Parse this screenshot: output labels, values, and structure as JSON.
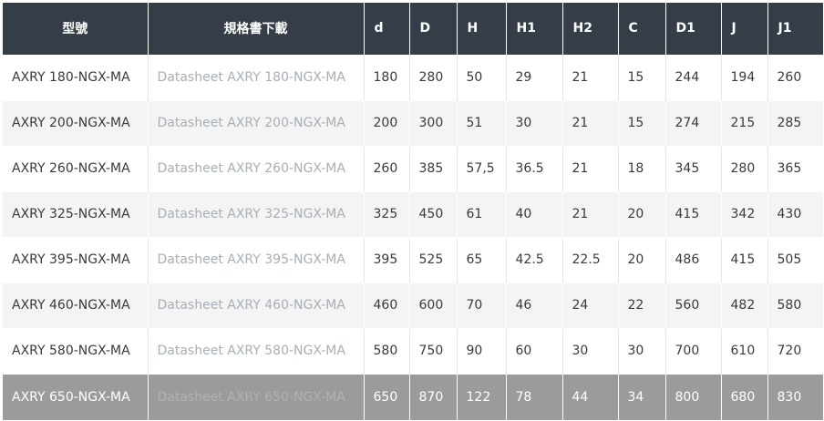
{
  "table": {
    "headers": [
      "型號",
      "規格書下載",
      "d",
      "D",
      "H",
      "H1",
      "H2",
      "C",
      "D1",
      "J",
      "J1"
    ],
    "rows": [
      [
        "AXRY 180-NGX-MA",
        "Datasheet AXRY 180-NGX-MA",
        "180",
        "280",
        "50",
        "29",
        "21",
        "15",
        "244",
        "194",
        "260"
      ],
      [
        "AXRY 200-NGX-MA",
        "Datasheet AXRY 200-NGX-MA",
        "200",
        "300",
        "51",
        "30",
        "21",
        "15",
        "274",
        "215",
        "285"
      ],
      [
        "AXRY 260-NGX-MA",
        "Datasheet AXRY 260-NGX-MA",
        "260",
        "385",
        "57,5",
        "36.5",
        "21",
        "18",
        "345",
        "280",
        "365"
      ],
      [
        "AXRY 325-NGX-MA",
        "Datasheet AXRY 325-NGX-MA",
        "325",
        "450",
        "61",
        "40",
        "21",
        "20",
        "415",
        "342",
        "430"
      ],
      [
        "AXRY 395-NGX-MA",
        "Datasheet AXRY 395-NGX-MA",
        "395",
        "525",
        "65",
        "42.5",
        "22.5",
        "20",
        "486",
        "415",
        "505"
      ],
      [
        "AXRY 460-NGX-MA",
        "Datasheet AXRY 460-NGX-MA",
        "460",
        "600",
        "70",
        "46",
        "24",
        "22",
        "560",
        "482",
        "580"
      ],
      [
        "AXRY 580-NGX-MA",
        "Datasheet AXRY 580-NGX-MA",
        "580",
        "750",
        "90",
        "60",
        "30",
        "30",
        "700",
        "610",
        "720"
      ],
      [
        "AXRY 650-NGX-MA",
        "Datasheet AXRY 650-NGX-MA",
        "650",
        "870",
        "122",
        "78",
        "44",
        "34",
        "800",
        "680",
        "830"
      ]
    ],
    "highlighted_row": 7
  },
  "colors": {
    "header_bg": "#343d48",
    "header_text": "#ffffff",
    "row_alt_bg": "#f4f4f4",
    "link_text": "#a8aeb6",
    "highlight_bg": "#9b9b9b"
  }
}
